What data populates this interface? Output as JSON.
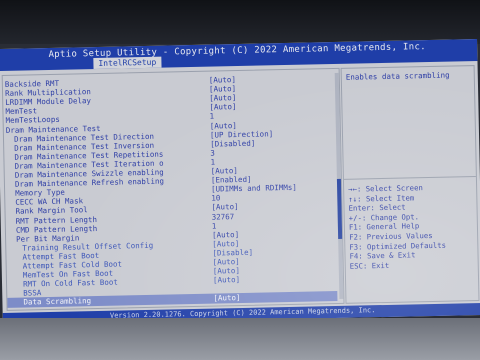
{
  "window": {
    "title": "Aptio Setup Utility - Copyright (C) 2022 American Megatrends, Inc.",
    "tab": "IntelRCSetup"
  },
  "settings": [
    {
      "label": "Backside RMT",
      "value": "[Auto]",
      "indent": 0
    },
    {
      "label": "Rank Multiplication",
      "value": "[Auto]",
      "indent": 0
    },
    {
      "label": "LRDIMM Module Delay",
      "value": "[Auto]",
      "indent": 0
    },
    {
      "label": "MemTest",
      "value": "[Auto]",
      "indent": 0
    },
    {
      "label": "MemTestLoops",
      "value": "1",
      "indent": 0
    },
    {
      "label": "Dram Maintenance Test",
      "value": "[Auto]",
      "indent": 0
    },
    {
      "label": "Dram Maintenance Test Direction",
      "value": "[UP Direction]",
      "indent": 1
    },
    {
      "label": "Dram Maintenance Test Inversion",
      "value": "[Disabled]",
      "indent": 1
    },
    {
      "label": "Dram Maintenance Test Repetitions",
      "value": "3",
      "indent": 1
    },
    {
      "label": "Dram Maintenance Test Iteration o",
      "value": "1",
      "indent": 1
    },
    {
      "label": "Dram Maintenance Swizzle enabling",
      "value": "[Auto]",
      "indent": 1
    },
    {
      "label": "Dram Maintenance Refresh enabling",
      "value": "[Enabled]",
      "indent": 1
    },
    {
      "label": "Memory Type",
      "value": "[UDIMMs and RDIMMs]",
      "indent": 1
    },
    {
      "label": "CECC WA CH Mask",
      "value": "10",
      "indent": 1
    },
    {
      "label": "Rank Margin Tool",
      "value": "[Auto]",
      "indent": 1
    },
    {
      "label": "RMT Pattern Length",
      "value": "32767",
      "indent": 1
    },
    {
      "label": "CMD Pattern Length",
      "value": "1",
      "indent": 1
    },
    {
      "label": "Per Bit Margin",
      "value": "[Auto]",
      "indent": 1
    },
    {
      "label": "Training Result Offset Config",
      "value": "[Auto]",
      "indent": 2
    },
    {
      "label": "Attempt Fast Boot",
      "value": "[Disable]",
      "indent": 2
    },
    {
      "label": "Attempt Fast Cold Boot",
      "value": "[Auto]",
      "indent": 2
    },
    {
      "label": "MemTest On Fast Boot",
      "value": "[Auto]",
      "indent": 2
    },
    {
      "label": "RMT On Cold Fast Boot",
      "value": "[Auto]",
      "indent": 2
    },
    {
      "label": "BSSA",
      "value": "",
      "indent": 2
    },
    {
      "label": "Data Scrambling",
      "value": "[Auto]",
      "indent": 2,
      "selected": true
    }
  ],
  "help": {
    "text": "Enables data scrambling"
  },
  "keys": [
    "→←: Select Screen",
    "↑↓: Select Item",
    "Enter: Select",
    "+/-: Change Opt.",
    "F1: General Help",
    "F2: Previous Values",
    "F3: Optimized Defaults",
    "F4: Save & Exit",
    "ESC: Exit"
  ],
  "footer": {
    "text": "Version 2.20.1276. Copyright (C) 2022 American Megatrends, Inc."
  }
}
